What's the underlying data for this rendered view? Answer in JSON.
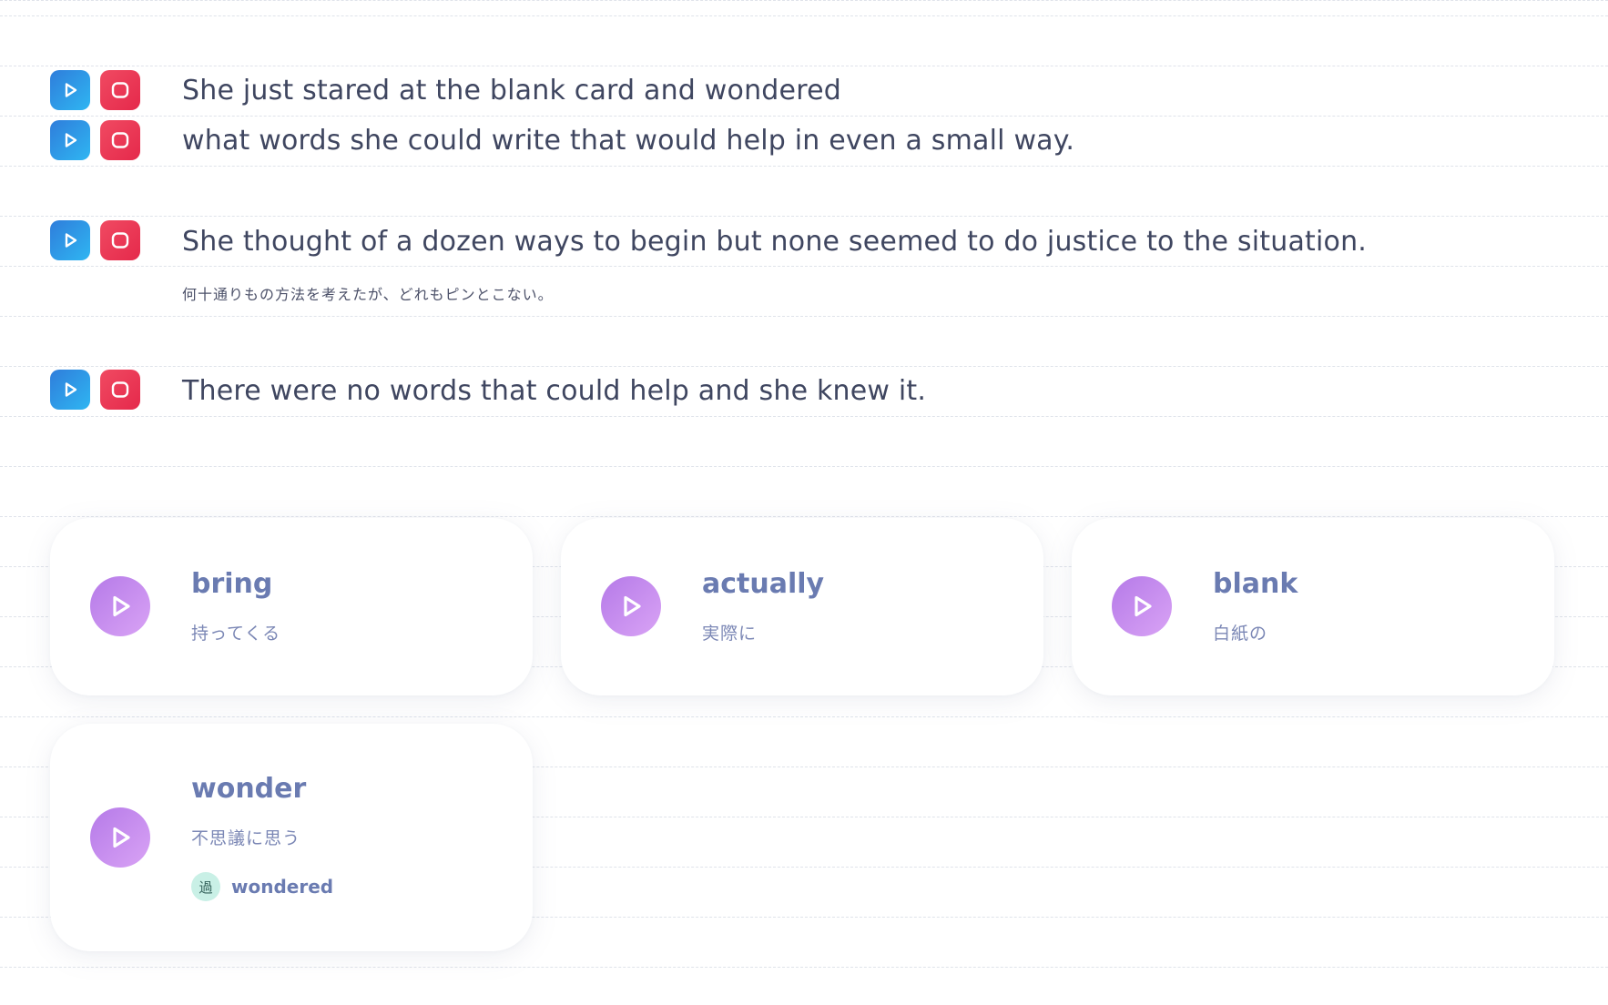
{
  "sentences": [
    {
      "text": "She just stared at the blank card and wondered",
      "translation": ""
    },
    {
      "text": "what words she could write that would help in even a small way.",
      "translation": ""
    },
    {
      "text": "She thought of a dozen ways to begin but none seemed to do justice to the situation.",
      "translation": "何十通りもの方法を考えたが、どれもピンとこない。"
    },
    {
      "text": "There were no words that could help and she knew it.",
      "translation": ""
    }
  ],
  "vocab": [
    {
      "word": "bring",
      "meaning": "持ってくる"
    },
    {
      "word": "actually",
      "meaning": "実際に"
    },
    {
      "word": "blank",
      "meaning": "白紙の"
    },
    {
      "word": "wonder",
      "meaning": "不思議に思う",
      "tag_badge": "過",
      "tag_text": "wondered"
    }
  ],
  "icons": {
    "sentence_play": "play-icon",
    "sentence_record": "record-icon",
    "vocab_play": "play-icon"
  },
  "colors": {
    "play_button": "#2f9be6",
    "record_button": "#ec3a57",
    "vocab_play_button": "#c48ef0",
    "vocab_word": "#6a7bb1",
    "past_tense_badge": "#c9f0e6"
  }
}
